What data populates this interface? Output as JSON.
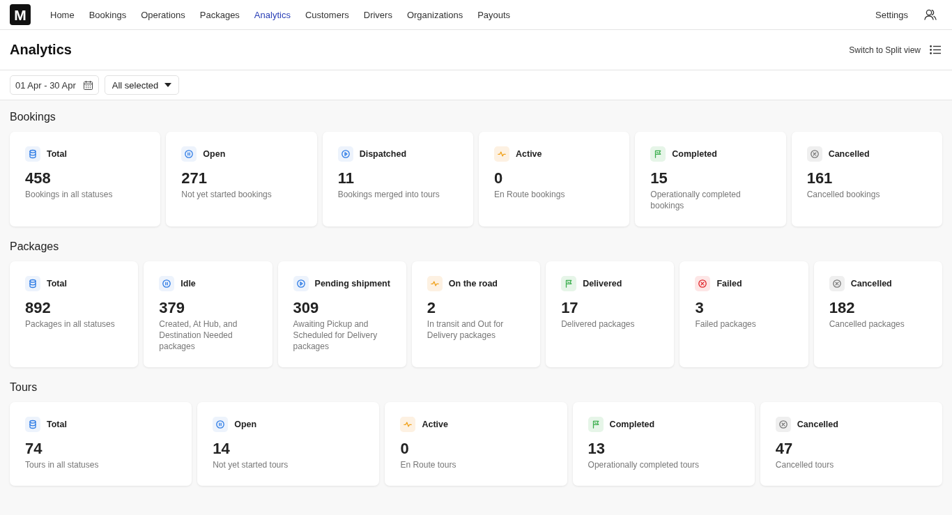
{
  "nav": {
    "logo": "M",
    "items": [
      {
        "label": "Home",
        "selected": false
      },
      {
        "label": "Bookings",
        "selected": false
      },
      {
        "label": "Operations",
        "selected": false
      },
      {
        "label": "Packages",
        "selected": false
      },
      {
        "label": "Analytics",
        "selected": true
      },
      {
        "label": "Customers",
        "selected": false
      },
      {
        "label": "Drivers",
        "selected": false
      },
      {
        "label": "Organizations",
        "selected": false
      },
      {
        "label": "Payouts",
        "selected": false
      }
    ],
    "settings": "Settings"
  },
  "header": {
    "title": "Analytics",
    "split_view": "Switch to Split view"
  },
  "filters": {
    "date_range": "01 Apr - 30 Apr",
    "status_dropdown": "All selected"
  },
  "sections": [
    {
      "title": "Bookings",
      "cards": [
        {
          "kind": "total",
          "label": "Total",
          "value": "458",
          "description": "Bookings in all statuses"
        },
        {
          "kind": "open",
          "label": "Open",
          "value": "271",
          "description": "Not yet started bookings"
        },
        {
          "kind": "dispatched",
          "label": "Dispatched",
          "value": "11",
          "description": "Bookings merged into tours"
        },
        {
          "kind": "active",
          "label": "Active",
          "value": "0",
          "description": "En Route bookings"
        },
        {
          "kind": "completed",
          "label": "Completed",
          "value": "15",
          "description": "Operationally completed bookings"
        },
        {
          "kind": "cancelled",
          "label": "Cancelled",
          "value": "161",
          "description": "Cancelled bookings"
        }
      ]
    },
    {
      "title": "Packages",
      "cards": [
        {
          "kind": "total",
          "label": "Total",
          "value": "892",
          "description": "Packages in all statuses"
        },
        {
          "kind": "open",
          "label": "Idle",
          "value": "379",
          "description": "Created, At Hub, and Destination Needed packages"
        },
        {
          "kind": "dispatched",
          "label": "Pending shipment",
          "value": "309",
          "description": "Awaiting Pickup and Scheduled for Delivery packages"
        },
        {
          "kind": "active",
          "label": "On the road",
          "value": "2",
          "description": "In transit and Out for Delivery packages"
        },
        {
          "kind": "completed",
          "label": "Delivered",
          "value": "17",
          "description": "Delivered packages"
        },
        {
          "kind": "failed",
          "label": "Failed",
          "value": "3",
          "description": "Failed packages"
        },
        {
          "kind": "cancelled",
          "label": "Cancelled",
          "value": "182",
          "description": "Cancelled packages"
        }
      ]
    },
    {
      "title": "Tours",
      "cards": [
        {
          "kind": "total",
          "label": "Total",
          "value": "74",
          "description": "Tours in all statuses"
        },
        {
          "kind": "open",
          "label": "Open",
          "value": "14",
          "description": "Not yet started tours"
        },
        {
          "kind": "active",
          "label": "Active",
          "value": "0",
          "description": "En Route tours"
        },
        {
          "kind": "completed",
          "label": "Completed",
          "value": "13",
          "description": "Operationally completed tours"
        },
        {
          "kind": "cancelled",
          "label": "Cancelled",
          "value": "47",
          "description": "Cancelled tours"
        }
      ]
    }
  ]
}
